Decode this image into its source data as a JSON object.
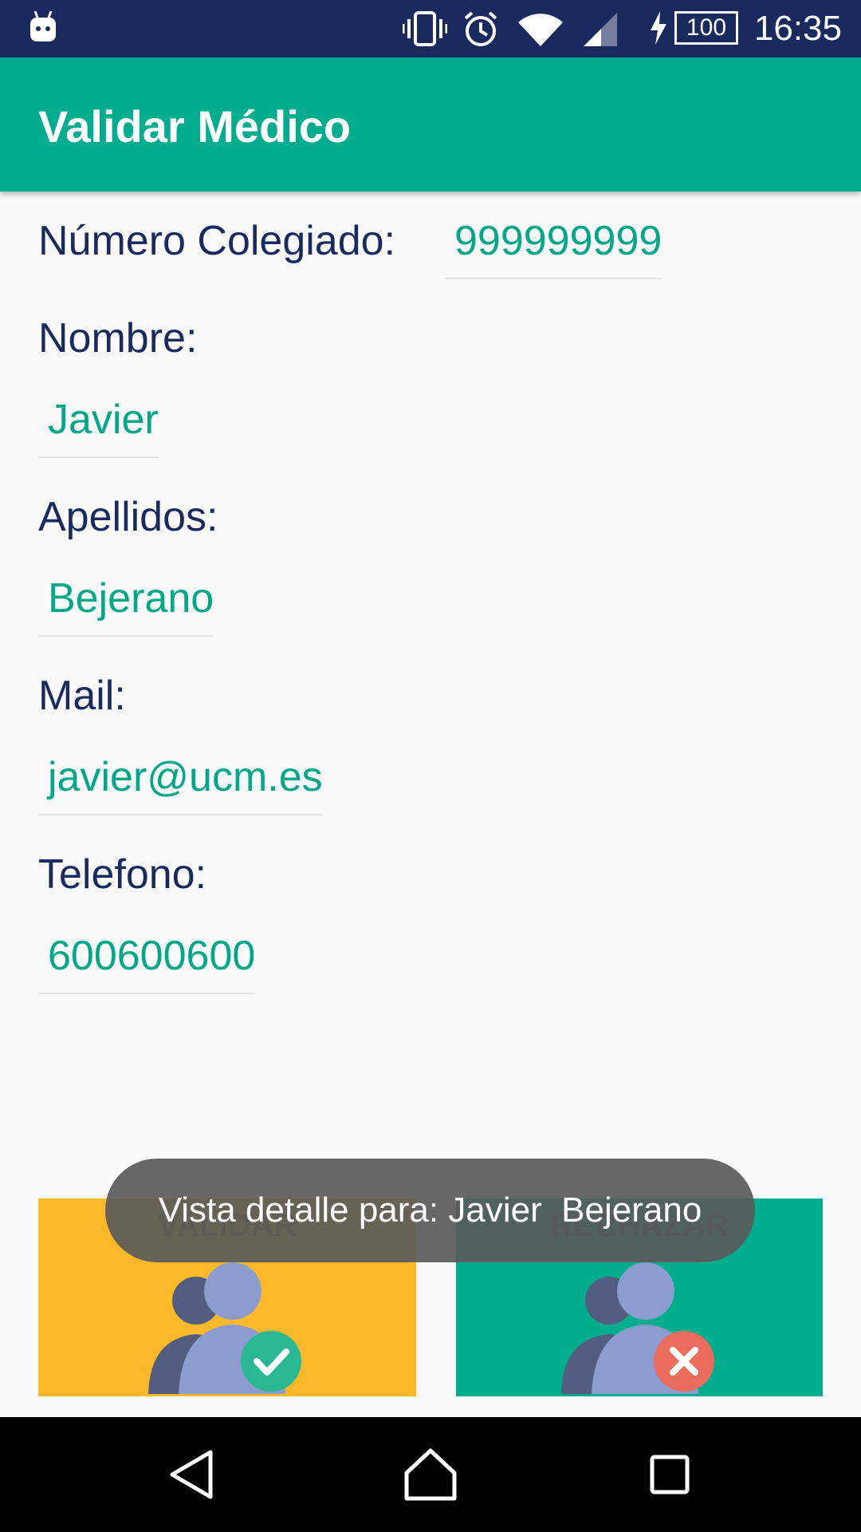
{
  "status_bar": {
    "time": "16:35",
    "battery": "100",
    "icons": [
      "android-icon",
      "vibrate-icon",
      "alarm-icon",
      "wifi-icon",
      "signal-icon",
      "charging-icon",
      "battery-icon"
    ]
  },
  "app_bar": {
    "title": "Validar Médico"
  },
  "form": {
    "numero_label": "Número Colegiado:",
    "numero_value": "999999999",
    "nombre_label": "Nombre:",
    "nombre_value": "Javier",
    "apellidos_label": "Apellidos:",
    "apellidos_value": "Bejerano",
    "mail_label": "Mail:",
    "mail_value": "javier@ucm.es",
    "telefono_label": "Telefono:",
    "telefono_value": "600600600"
  },
  "actions": {
    "validar_label": "VALIDAR",
    "rechazar_label": "RECHAZAR",
    "validar_color": "#fbb829",
    "rechazar_color": "#00ad8c"
  },
  "toast": {
    "text": "Vista detalle para: Javier  Bejerano"
  },
  "nav_bar": {
    "buttons": [
      "back-icon",
      "home-icon",
      "recents-icon"
    ]
  }
}
